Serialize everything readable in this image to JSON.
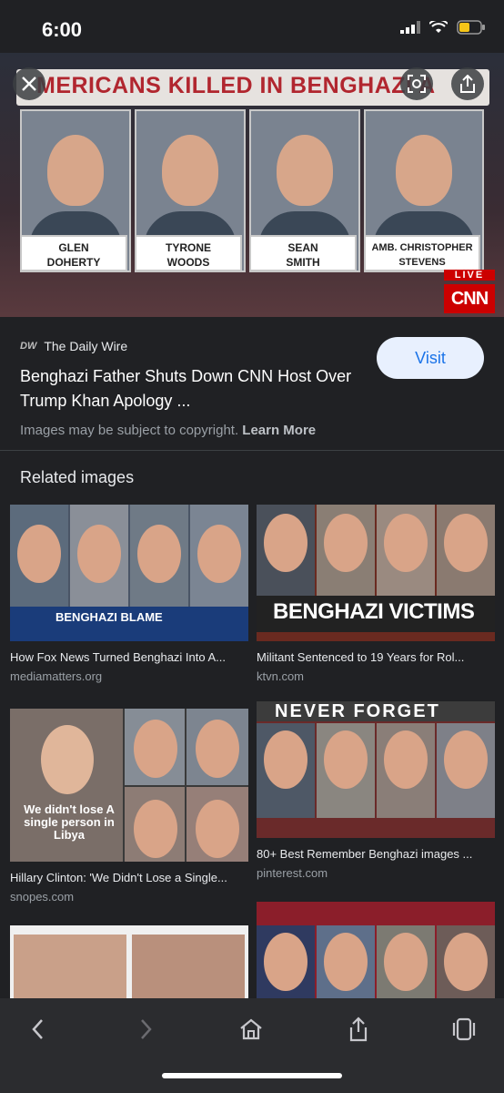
{
  "status": {
    "time": "6:00"
  },
  "hero": {
    "headline": "MERICANS KILLED IN BENGHAZI A",
    "people": [
      {
        "name_line1": "GLEN",
        "name_line2": "DOHERTY"
      },
      {
        "name_line1": "TYRONE",
        "name_line2": "WOODS"
      },
      {
        "name_line1": "SEAN",
        "name_line2": "SMITH"
      },
      {
        "name_line1": "AMB. CHRISTOPHER",
        "name_line2": "STEVENS"
      }
    ],
    "live_label": "LIVE",
    "network_label": "CNN"
  },
  "result": {
    "source": "The Daily Wire",
    "source_logo": "DW",
    "title": "Benghazi Father Shuts Down CNN Host Over Trump Khan Apology ...",
    "visit_label": "Visit",
    "copyright_text": "Images may be subject to copyright.",
    "learn_more": "Learn More"
  },
  "related": {
    "title": "Related images",
    "items": [
      {
        "caption": "How Fox News Turned Benghazi Into A...",
        "domain": "mediamatters.org",
        "overlay": "BENGHAZI BLAME"
      },
      {
        "caption": "Militant Sentenced to 19 Years for Rol...",
        "domain": "ktvn.com",
        "overlay": "BENGHAZI VICTIMS"
      },
      {
        "caption": "Hillary Clinton: 'We Didn't Lose a Single...",
        "domain": "snopes.com",
        "overlay": "We didn't lose A single person in Libya"
      },
      {
        "caption": "80+ Best Remember Benghazi images ...",
        "domain": "pinterest.com",
        "overlay": "NEVER FORGET"
      }
    ]
  }
}
